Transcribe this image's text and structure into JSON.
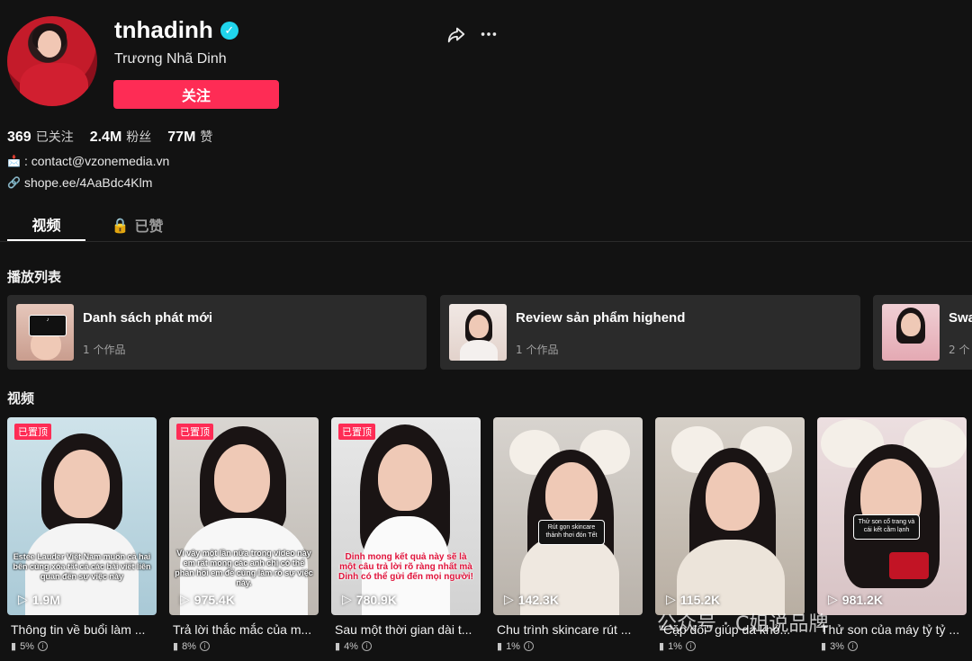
{
  "profile": {
    "username": "tnhadinh",
    "nickname": "Trương Nhã Dinh",
    "follow_label": "关注",
    "stats": [
      {
        "value": "369",
        "label": "已关注"
      },
      {
        "value": "2.4M",
        "label": "粉丝"
      },
      {
        "value": "77M",
        "label": "赞"
      }
    ],
    "bio_email": ": contact@vzonemedia.vn",
    "bio_link": "shope.ee/4AaBdc4Klm"
  },
  "tabs": [
    {
      "label": "视频"
    },
    {
      "label": "已赞"
    }
  ],
  "sections": {
    "playlists": "播放列表",
    "videos": "视频"
  },
  "playlists": [
    {
      "title": "Danh sách phát mới",
      "count": "1 个作品"
    },
    {
      "title": "Review sản phẩm highend",
      "count": "1 个作品"
    },
    {
      "title": "Swa",
      "count": "2 个"
    }
  ],
  "videos": [
    {
      "pinned": "已置顶",
      "plays": "1.9M",
      "title": "Thông tin về buổi làm ...",
      "stat": "5%",
      "overlay": "Estee Lauder Việt Nam muốn cả hai bên cùng xóa tất cả các bài viết liên quan đến sự việc này"
    },
    {
      "pinned": "已置顶",
      "plays": "975.4K",
      "title": "Trả lời thắc mắc của m...",
      "stat": "8%",
      "overlay": "Vì vậy một lần nữa trong video này em rất mong các anh chị có thể phản hồi em để cùng làm rõ sự việc này."
    },
    {
      "pinned": "已置顶",
      "plays": "780.9K",
      "title": "Sau một thời gian dài t...",
      "stat": "4%",
      "overlay": "Dinh mong kết quả này sẽ là một câu trả lời rõ ràng nhất mà Dinh có thể gửi đến mọi người!"
    },
    {
      "pinned": "",
      "plays": "142.3K",
      "title": "Chu trình skincare rút ...",
      "stat": "1%",
      "overlay": "Rút gọn skincare thảnh thơi đón Tết"
    },
    {
      "pinned": "",
      "plays": "115.2K",
      "title": "\"Cặp đôi\" giúp da khỏ...",
      "stat": "1%",
      "overlay": ""
    },
    {
      "pinned": "",
      "plays": "981.2K",
      "title": "Thử son của máy tỷ tỷ ...",
      "stat": "3%",
      "overlay": "Thử son cổ trang và cái kết cằm lạnh"
    }
  ],
  "watermark": "公众号 · C姐说品牌",
  "colors": {
    "accent": "#fe2c55",
    "verified": "#20d5ec",
    "background": "#121212",
    "card": "#2b2b2b"
  }
}
